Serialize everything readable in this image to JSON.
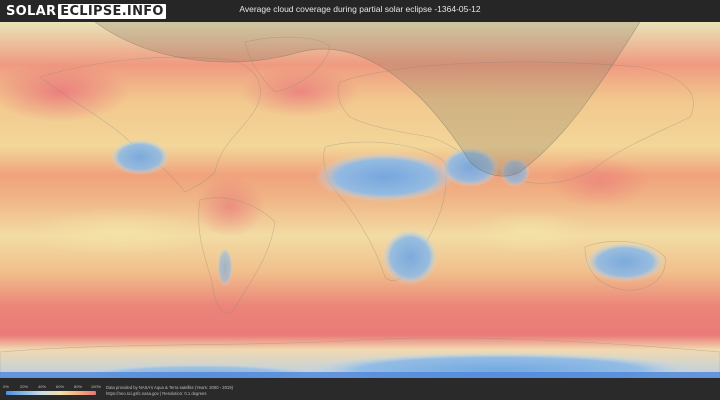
{
  "header": {
    "logo_part1": "SOLAR",
    "logo_part2": "ECLIPSE.INFO",
    "title": "Average cloud coverage during partial solar eclipse -1364-05-12"
  },
  "map": {
    "kind": "world cloud coverage map, equirectangular",
    "eclipse_shading": "partial eclipse visibility zone over Europe, North Africa, Middle East and Asia"
  },
  "legend": {
    "ticks": [
      "0%",
      "20%",
      "40%",
      "60%",
      "80%",
      "100%"
    ],
    "colors": [
      "#4a90e2",
      "#87b7e8",
      "#c9dfe8",
      "#f0e2a8",
      "#f3b07c",
      "#e8737a"
    ]
  },
  "footer": {
    "credit_line1": "Data provided by NASA's Aqua & Terra satellite (Years: 2000 - 2019)",
    "credit_line2": "https://neo.sci.gsfc.nasa.gov  |  Resolution: 0.1 degrees"
  }
}
